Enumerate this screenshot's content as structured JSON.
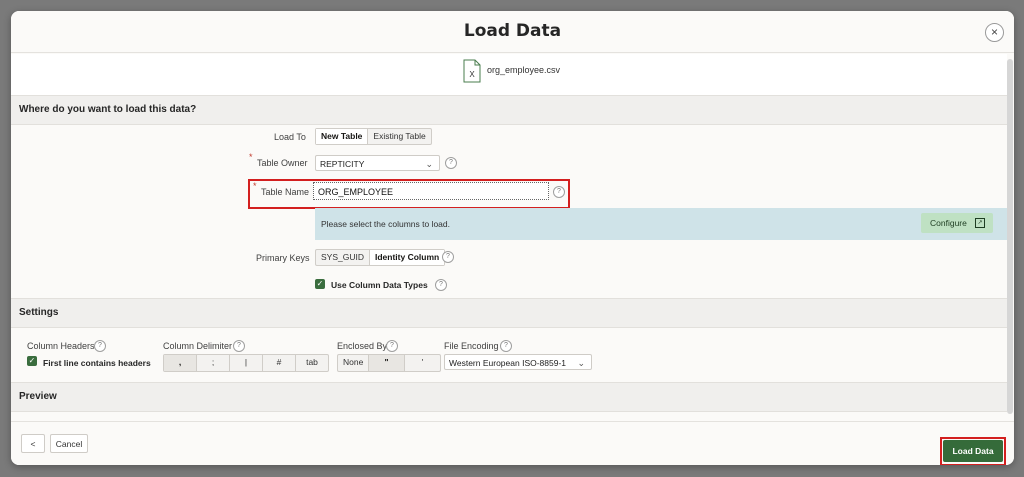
{
  "dialog": {
    "title": "Load Data",
    "close_label": "×",
    "file_name": "org_employee.csv",
    "file_icon_glyph": "X"
  },
  "where": {
    "heading": "Where do you want to load this data?",
    "load_to_label": "Load To",
    "load_to_options": [
      "New Table",
      "Existing Table"
    ],
    "load_to_selected": "New Table",
    "owner_label": "Table Owner",
    "owner_value": "REPTICITY",
    "table_name_label": "Table Name",
    "table_name_value": "ORG_EMPLOYEE",
    "info_message": "Please select the columns to load.",
    "configure_label": "Configure",
    "primary_keys_label": "Primary Keys",
    "primary_keys_options": [
      "SYS_GUID",
      "Identity Column"
    ],
    "primary_keys_selected": "Identity Column",
    "use_types_label": "Use Column Data Types",
    "use_types_checked": true,
    "required_mark": "*",
    "help_glyph": "?"
  },
  "settings": {
    "heading": "Settings",
    "column_headers_label": "Column Headers",
    "first_line_label": "First line contains headers",
    "first_line_checked": true,
    "delimiter_label": "Column Delimiter",
    "delimiter_options": [
      ",",
      ";",
      "|",
      "#",
      "tab"
    ],
    "delimiter_selected": ",",
    "enclosed_label": "Enclosed By",
    "enclosed_options": [
      "None",
      "\"",
      "'"
    ],
    "enclosed_selected": "\"",
    "encoding_label": "File Encoding",
    "encoding_value": "Western European ISO-8859-1"
  },
  "preview": {
    "heading": "Preview"
  },
  "footer": {
    "back_glyph": "<",
    "cancel_label": "Cancel",
    "load_label": "Load Data"
  },
  "colors": {
    "primary_button": "#356b3a",
    "info_bar": "#cfe3e8",
    "highlight": "#d31f1f"
  }
}
